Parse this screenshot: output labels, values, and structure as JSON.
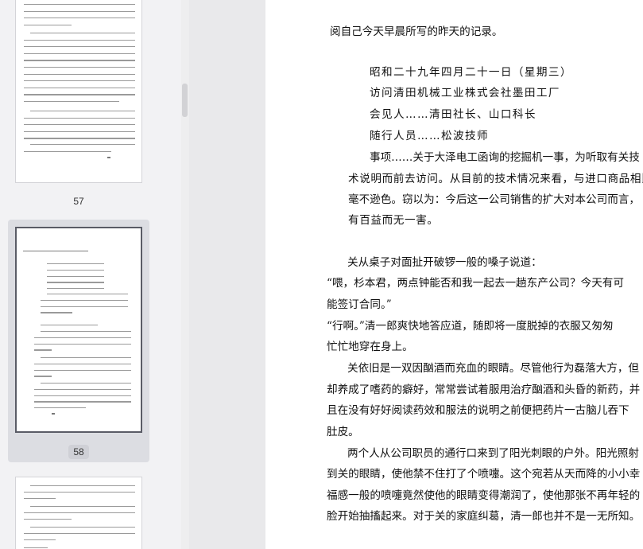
{
  "thumbnails": [
    {
      "label": "57"
    },
    {
      "label": "58",
      "selected": true
    },
    {
      "label": ""
    }
  ],
  "document": {
    "lines": [
      "阅自己今天早晨所写的昨天的记录。",
      "昭和二十九年四月二十一日（星期三）",
      "访问清田机械工业株式会社墨田工厂",
      "会见人……清田社长、山口科长",
      "随行人员……松波技师",
      "事项……关于大泽电工函询的挖掘机一事，为听取有关技",
      "术说明而前去访问。从目前的技术情况来看，与进口商品相比",
      "毫不逊色。窃以为：今后这一公司销售的扩大对本公司而言，",
      "有百益而无一害。",
      "关从桌子对面扯开破锣一般的嗓子说道：",
      "“喂，杉本君，两点钟能否和我一起去一趟东产公司？今天有可",
      "能签订合同。”",
      "“行啊。”清一郎爽快地答应道，随即将一度脱掉的衣服又匆匆",
      "忙忙地穿在身上。",
      "关依旧是一双因酗酒而充血的眼睛。尽管他行为磊落大方，但",
      "却养成了嗜药的癖好，常常尝试着服用治疗酗酒和头昏的新药，并",
      "且在没有好好阅读药效和服法的说明之前便把药片一古脑儿吞下",
      "肚皮。",
      "两个人从公司职员的通行口来到了阳光刺眼的户外。阳光照射",
      "到关的眼睛，使他禁不住打了个喷嚏。这个宛若从天而降的小小幸",
      "福感一般的喷嚏竟然使他的眼睛变得潮润了，使他那张不再年轻的",
      "脸开始抽搐起来。对于关的家庭纠葛，清一郎也并不是一无所知。"
    ]
  }
}
